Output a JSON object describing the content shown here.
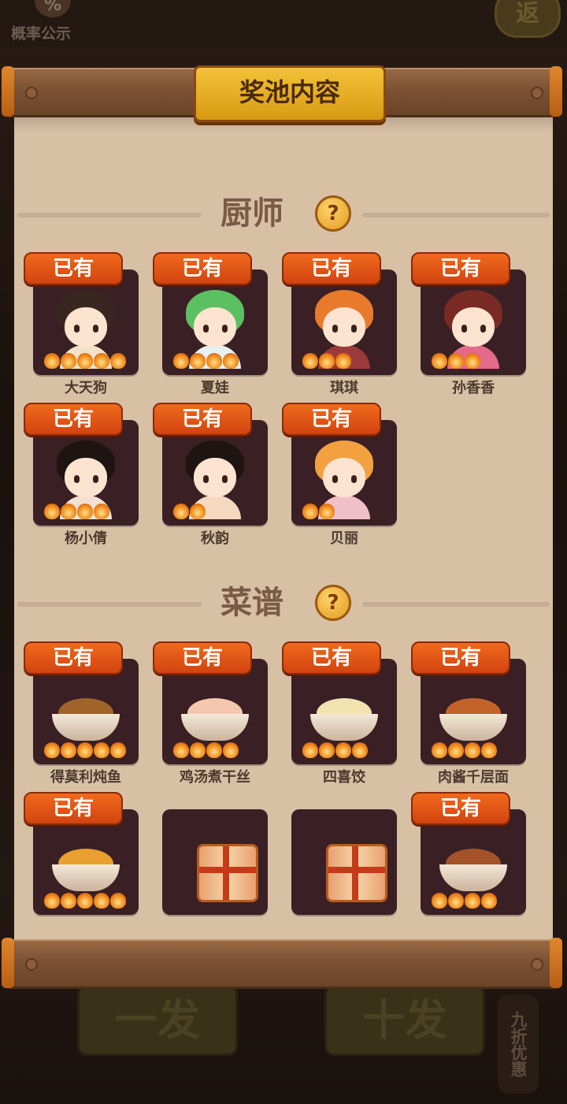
{
  "background": {
    "probability_icon": "%",
    "probability_label": "概率公示",
    "back_label": "返",
    "single_draw_label": "一发",
    "ten_draw_label": "十发",
    "discount_label": "九折优惠"
  },
  "panel": {
    "title": "奖池内容",
    "owned_label": "已有",
    "chef_section": {
      "title": "厨师",
      "help_icon": "?"
    },
    "recipe_section": {
      "title": "菜谱",
      "help_icon": "?"
    },
    "chefs": [
      {
        "name": "大天狗",
        "owned": true,
        "stars": 5,
        "hair": "#3a2620",
        "body": "#f2e2c8"
      },
      {
        "name": "夏娃",
        "owned": true,
        "stars": 4,
        "hair": "#5cc062",
        "body": "#e6f0f0"
      },
      {
        "name": "琪琪",
        "owned": true,
        "stars": 3,
        "hair": "#e87a2c",
        "body": "#9a3a3a"
      },
      {
        "name": "孙香香",
        "owned": true,
        "stars": 3,
        "hair": "#7a2a24",
        "body": "#e46a8a"
      },
      {
        "name": "杨小倩",
        "owned": true,
        "stars": 4,
        "hair": "#1e1412",
        "body": "#f2e0d2"
      },
      {
        "name": "秋韵",
        "owned": true,
        "stars": 2,
        "hair": "#1e1412",
        "body": "#f4d8c0"
      },
      {
        "name": "贝丽",
        "owned": true,
        "stars": 2,
        "hair": "#f2a040",
        "body": "#f0c0c8"
      }
    ],
    "recipes": [
      {
        "name": "得莫利炖鱼",
        "owned": true,
        "stars": 5,
        "food": "#a0642a"
      },
      {
        "name": "鸡汤煮干丝",
        "owned": true,
        "stars": 4,
        "food": "#f4c8b0"
      },
      {
        "name": "四喜饺",
        "owned": true,
        "stars": 4,
        "food": "#f2e2b0"
      },
      {
        "name": "肉酱千层面",
        "owned": true,
        "stars": 4,
        "food": "#c2642a"
      },
      {
        "name": "",
        "owned": true,
        "stars": 5,
        "food": "#e8a030"
      },
      {
        "name": "",
        "owned": false,
        "stars": 0,
        "mystery": true
      },
      {
        "name": "",
        "owned": false,
        "stars": 0,
        "mystery": true
      },
      {
        "name": "",
        "owned": true,
        "stars": 4,
        "food": "#a4522a"
      }
    ]
  }
}
